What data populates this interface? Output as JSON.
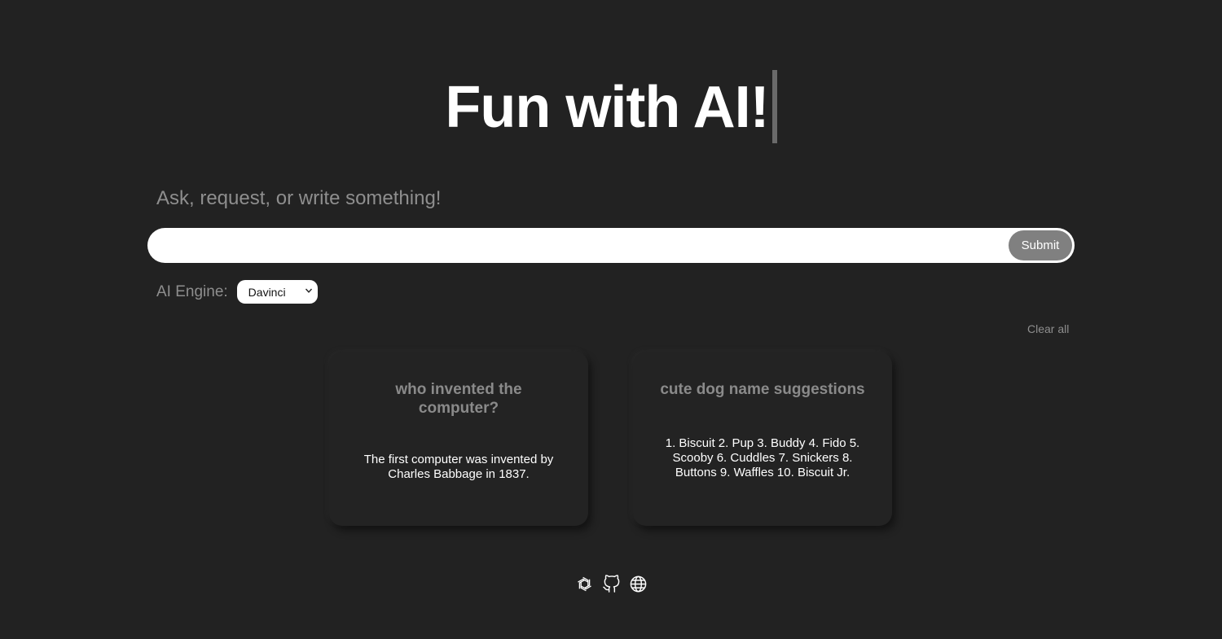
{
  "header": {
    "title": "Fun with AI!"
  },
  "prompt": {
    "label": "Ask, request, or write something!",
    "input_value": "",
    "submit_label": "Submit"
  },
  "engine": {
    "label": "AI Engine:",
    "selected": "Davinci"
  },
  "history": {
    "clear_label": "Clear all",
    "cards": [
      {
        "question": "who invented the computer?",
        "answer": "The first computer was invented by Charles Babbage in 1837."
      },
      {
        "question": "cute dog name suggestions",
        "answer": "1. Biscuit 2. Pup 3. Buddy 4. Fido 5. Scooby 6. Cuddles 7. Snickers 8. Buttons 9. Waffles 10. Biscuit Jr."
      }
    ]
  },
  "footer": {
    "icons": [
      "openai-icon",
      "github-icon",
      "globe-icon"
    ]
  },
  "colors": {
    "background": "#222222",
    "card": "#232323",
    "muted_text": "#8e8e8e",
    "submit_button": "#808080"
  }
}
